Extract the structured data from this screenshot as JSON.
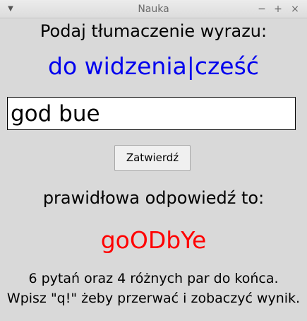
{
  "window": {
    "title": "Nauka",
    "menu_icon": "chevron-down-icon",
    "minimize_glyph": "−",
    "maximize_glyph": "+",
    "close_glyph": "×"
  },
  "quiz": {
    "prompt": "Podaj tłumaczenie wyrazu:",
    "word": "do widzenia|cześć",
    "word_color": "#0000ee",
    "answer_value": "god bue",
    "submit_label": "Zatwierdź",
    "correct_label": "prawidłowa odpowiedź to:",
    "correct_answer": "goODbYe",
    "correct_color": "#ff0000"
  },
  "status": {
    "line1": "6 pytań oraz 4 różnych par do końca.",
    "line2": "Wpisz \"q!\" żeby przerwać i zobaczyć wynik."
  }
}
